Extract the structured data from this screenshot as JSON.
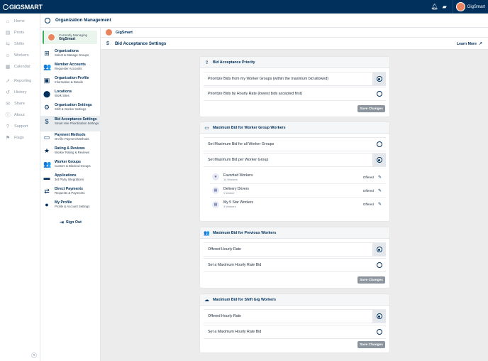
{
  "app": {
    "brand": "GIGSMART",
    "user_name": "GigSmart"
  },
  "left_nav": [
    {
      "icon": "home-icon",
      "glyph": "⌂",
      "label": "Home"
    },
    {
      "icon": "posts-icon",
      "glyph": "▤",
      "label": "Posts"
    },
    {
      "icon": "shifts-icon",
      "glyph": "⇆",
      "label": "Shifts"
    },
    {
      "icon": "workers-icon",
      "glyph": "☺",
      "label": "Workers"
    },
    {
      "icon": "calendar-icon",
      "glyph": "▦",
      "label": "Calendar"
    },
    {
      "icon": "reporting-icon",
      "glyph": "↗",
      "label": "Reporting"
    },
    {
      "icon": "history-icon",
      "glyph": "↺",
      "label": "History"
    },
    {
      "icon": "share-icon",
      "glyph": "✉",
      "label": "Share"
    },
    {
      "icon": "about-icon",
      "glyph": "ⓘ",
      "label": "About"
    },
    {
      "icon": "support-icon",
      "glyph": "?",
      "label": "Support"
    },
    {
      "icon": "flags-icon",
      "glyph": "⚑",
      "label": "Flags"
    }
  ],
  "org_header": {
    "title": "Organization Management"
  },
  "managing": {
    "label": "Currently Managing",
    "org": "GigSmart"
  },
  "sub_nav": [
    {
      "icon": "organizations-icon",
      "glyph": "⊞",
      "title": "Organizations",
      "sub": "Select & Manage Groups"
    },
    {
      "icon": "member-accounts-icon",
      "glyph": "👥",
      "title": "Member Accounts",
      "sub": "Requester Accounts"
    },
    {
      "icon": "organization-profile-icon",
      "glyph": "▣",
      "title": "Organization Profile",
      "sub": "Information & Details"
    },
    {
      "icon": "locations-icon",
      "glyph": "⬤",
      "title": "Locations",
      "sub": "Work Sites"
    },
    {
      "icon": "organization-settings-icon",
      "glyph": "⚙",
      "title": "Organization Settings",
      "sub": "Shift & Worker Settings"
    },
    {
      "icon": "bid-acceptance-icon",
      "glyph": "$",
      "title": "Bid Acceptance Settings",
      "sub": "Smart Hire Prioritization Settings",
      "active": true
    },
    {
      "icon": "payment-methods-icon",
      "glyph": "▭",
      "title": "Payment Methods",
      "sub": "On-file Payment Methods"
    },
    {
      "icon": "star-icon",
      "glyph": "★",
      "title": "Rating & Reviews",
      "sub": "Worker Rating & Reviews"
    },
    {
      "icon": "worker-groups-icon",
      "glyph": "👥",
      "title": "Worker Groups",
      "sub": "Custom & Blocked Groups"
    },
    {
      "icon": "applications-icon",
      "glyph": "▬",
      "title": "Applications",
      "sub": "3rd Party Integrations"
    },
    {
      "icon": "direct-payments-icon",
      "glyph": "⇄",
      "title": "Direct Payments",
      "sub": "Requests & Payments"
    },
    {
      "icon": "profile-icon",
      "glyph": "●",
      "title": "My Profile",
      "sub": "Profile & Account Settings"
    }
  ],
  "sign_out": "Sign Out",
  "breadcrumb": {
    "org": "GigSmart"
  },
  "page": {
    "title": "Bid Acceptance Settings",
    "learn_more": "Learn More"
  },
  "cards": {
    "priority": {
      "title": "Bid Acceptance Priority",
      "options": [
        {
          "label": "Prioritize Bids from my Worker Groups (within the maximum bid allowed)",
          "selected": true
        },
        {
          "label": "Prioritize Bids by Hourly Rate (lowest bids accepted first)",
          "selected": false
        }
      ],
      "save": "Save Changes"
    },
    "worker_group": {
      "title": "Maximum Bid for Worker Group Workers",
      "options": [
        {
          "label": "Set Maximum Bid for all Worker Groups",
          "selected": false
        },
        {
          "label": "Set Maximum Bid per Worker Group",
          "selected": true
        }
      ],
      "groups": [
        {
          "name": "Favorited Workers",
          "count": "14 Workers",
          "status": "Offered",
          "glyph": "★"
        },
        {
          "name": "Delivery Drivers",
          "count": "1 Worker",
          "status": "Offered",
          "glyph": "▦"
        },
        {
          "name": "My 5 Star Workers",
          "count": "3 Workers",
          "status": "Offered",
          "glyph": "▦"
        }
      ]
    },
    "previous": {
      "title": "Maximum Bid for Previous Workers",
      "options": [
        {
          "label": "Offered Hourly Rate",
          "selected": true
        },
        {
          "label": "Set a Maximum Hourly Rate Bid",
          "selected": false
        }
      ],
      "save": "Save Changes"
    },
    "shift_gig": {
      "title": "Maximum Bid for Shift Gig Workers",
      "options": [
        {
          "label": "Offered Hourly Rate",
          "selected": true
        },
        {
          "label": "Set a Maximum Hourly Rate Bid",
          "selected": false
        }
      ],
      "save": "Save Changes"
    }
  }
}
